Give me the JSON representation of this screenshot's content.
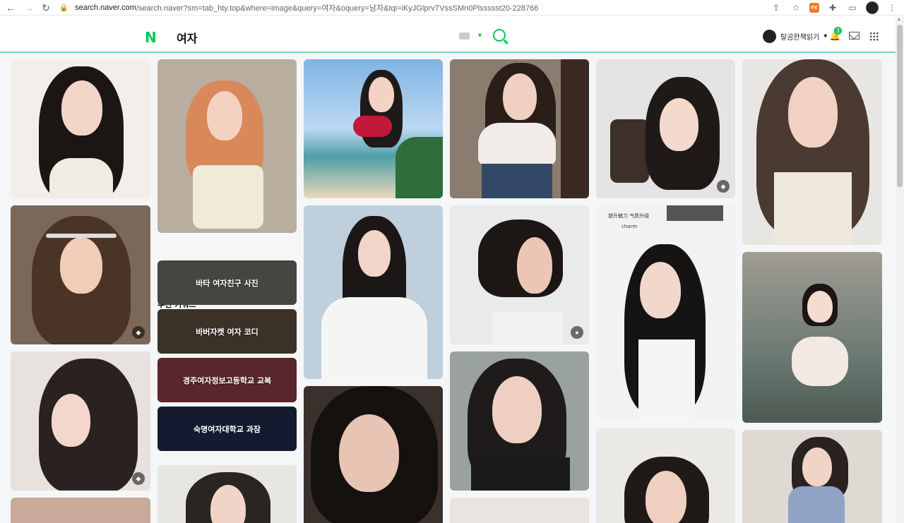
{
  "browser": {
    "url_host": "search.naver.com",
    "url_rest": "/search.naver?sm=tab_hty.top&where=image&query=여자&oquery=남자&tqi=iKyJGlprvTVssSMn0Plssssst20-228766",
    "ext_label": "FX"
  },
  "header": {
    "logo": "N",
    "query": "여자",
    "user_name": "탈곰한책읽기",
    "user_dropdown": "▾",
    "notification_count": "3"
  },
  "keywords": {
    "title": "추천 키워드",
    "items": [
      {
        "label": "바타 여자친구 사진"
      },
      {
        "label": "바버자켓 여자 코디"
      },
      {
        "label": "경주여자정보고등학교 교복"
      },
      {
        "label": "숙명여자대학교 과잠"
      }
    ]
  },
  "tile_texts": {
    "promo": "提升魅力 气质升级",
    "charm": "charm"
  },
  "icons": {
    "back": "arrow-left-icon",
    "forward": "arrow-right-icon",
    "reload": "reload-icon",
    "lock": "lock-icon",
    "share": "share-icon",
    "star": "star-icon",
    "puzzle": "extensions-icon",
    "sidebar": "sidebar-icon",
    "shop": "shopping-bag-icon",
    "location": "location-pin-icon"
  }
}
